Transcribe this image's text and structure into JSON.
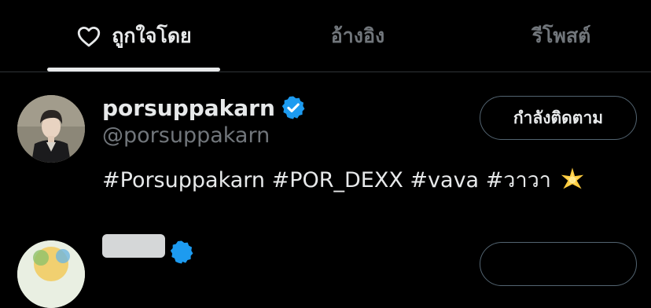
{
  "tabs": [
    {
      "label": "ถูกใจโดย",
      "active": true,
      "icon": "heart-icon"
    },
    {
      "label": "อ้างอิง",
      "active": false
    },
    {
      "label": "รีโพสต์",
      "active": false
    }
  ],
  "users": [
    {
      "display_name": "porsuppakarn",
      "handle": "@porsuppakarn",
      "verified": true,
      "bio": "#Porsuppakarn #POR_DEXX #vava #วาวา",
      "bio_emoji": "sparkle-star-icon",
      "follow_label": "กำลังติดตาม"
    }
  ],
  "colors": {
    "background": "#000000",
    "text": "#e7e9ea",
    "secondary": "#71767b",
    "verified": "#1d9bf0",
    "border": "#2f3336"
  }
}
